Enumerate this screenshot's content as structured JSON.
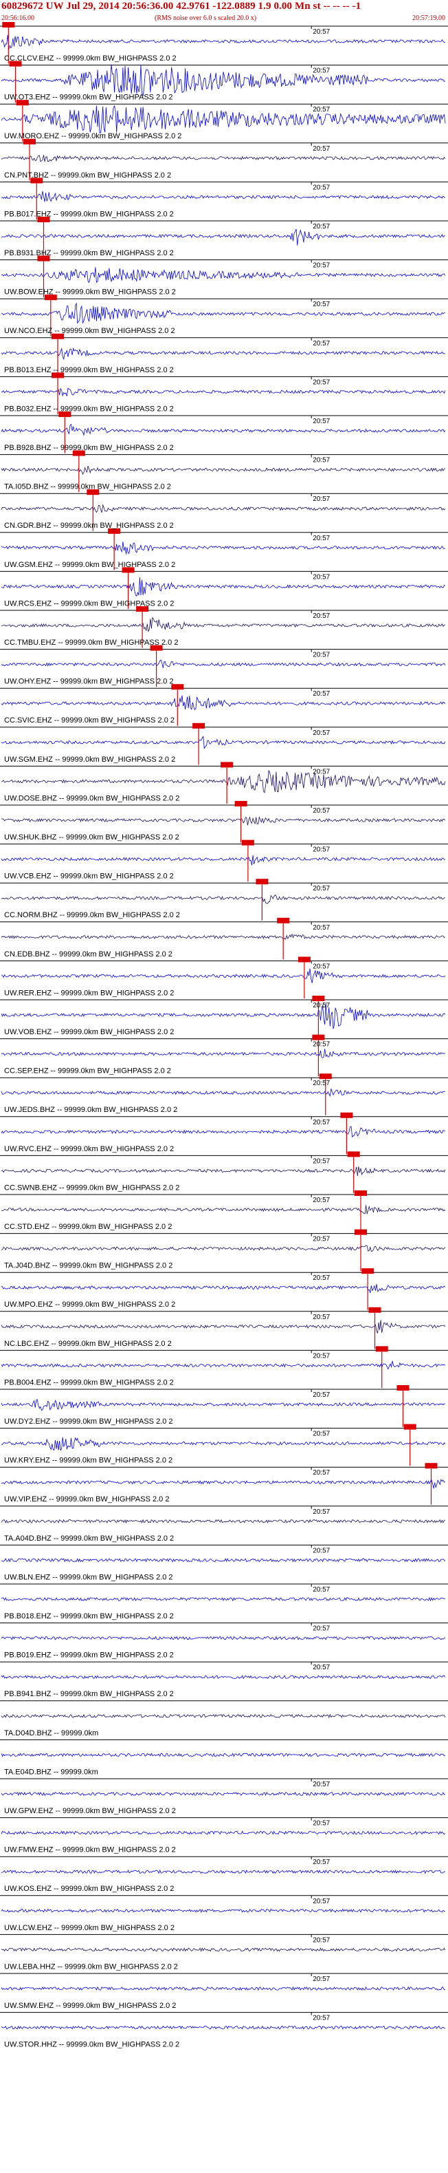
{
  "header": {
    "title": "60829672 UW Jul 29, 2014 20:56:36.00    42.9761 -122.0889  1.9 0.00 Mn st -- -- --  -1",
    "start_time": "20:56:16.00",
    "scale_note": "(RMS noise over 6.0 s scaled 20.0 x)",
    "end_time": "20:57:19.00"
  },
  "colors": {
    "trace_blue": "#0000ee",
    "trace_dark": "#1a0a66",
    "pick_red": "#dd0000",
    "baseline": "#000000",
    "header_red": "#c00000"
  },
  "chart_data": {
    "type": "line",
    "title": "60829672 UW Jul 29, 2014 20:56:36.00    42.9761 -122.0889  1.9 0.00 Mn st -- -- --  -1",
    "time_axis": {
      "start": "20:56:16.00",
      "end": "20:57:19.00"
    },
    "tick_label": "20:57",
    "series": [
      {
        "name": "CC.CLCV.EHZ -- 99999.0km BW_HIGHPASS  2.0  2",
        "color": "#0000ee",
        "pick": "20:56:17",
        "burst_start": "20:56:16",
        "burst_end": "20:56:22",
        "amp": 0.55
      },
      {
        "name": "UW.OT3.EHZ -- 99999.0km BW_HIGHPASS  2.0  2",
        "color": "#0000ee",
        "pick": "20:56:18",
        "burst_start": "20:56:25",
        "burst_end": "20:57:08",
        "amp": 1.0
      },
      {
        "name": "UW.MORO.EHZ -- 99999.0km BW_HIGHPASS  2.0  2",
        "color": "#0000ee",
        "pick": "20:56:19",
        "burst_start": "20:56:19",
        "burst_end": "20:57:19",
        "amp": 0.8
      },
      {
        "name": "CN.PNT.BHZ -- 99999.0km BW_HIGHPASS  2.0  2",
        "color": "#1a0a66",
        "pick": "20:56:20",
        "burst_start": "20:56:20",
        "burst_end": "20:56:28",
        "amp": 0.15
      },
      {
        "name": "PB.B017.EHZ -- 99999.0km BW_HIGHPASS  2.0  2",
        "color": "#0000ee",
        "pick": "20:56:21",
        "burst_start": "20:56:21",
        "burst_end": "20:56:26",
        "amp": 0.3
      },
      {
        "name": "PB.B931.BHZ -- 99999.0km BW_HIGHPASS  2.0  2",
        "color": "#0000ee",
        "pick": "20:56:22",
        "burst_start": "20:56:57",
        "burst_end": "20:57:01",
        "amp": 0.55
      },
      {
        "name": "UW.BOW.EHZ -- 99999.0km BW_HIGHPASS  2.0  2",
        "color": "#0000ee",
        "pick": "20:56:22",
        "burst_start": "20:56:22",
        "burst_end": "20:56:58",
        "amp": 0.4
      },
      {
        "name": "UW.NCO.EHZ -- 99999.0km BW_HIGHPASS  2.0  2",
        "color": "#0000ee",
        "pick": "20:56:23",
        "burst_start": "20:56:23",
        "burst_end": "20:56:40",
        "amp": 0.6
      },
      {
        "name": "PB.B013.EHZ -- 99999.0km BW_HIGHPASS  2.0  2",
        "color": "#0000ee",
        "pick": "20:56:24",
        "burst_start": "20:56:24",
        "burst_end": "20:56:29",
        "amp": 0.3
      },
      {
        "name": "PB.B032.EHZ -- 99999.0km BW_HIGHPASS  2.0  2",
        "color": "#0000ee",
        "pick": "20:56:24",
        "burst_start": "20:56:24",
        "burst_end": "20:56:28",
        "amp": 0.3
      },
      {
        "name": "PB.B928.BHZ -- 99999.0km BW_HIGHPASS  2.0  2",
        "color": "#0000ee",
        "pick": "20:56:25",
        "burst_start": "20:56:25",
        "burst_end": "20:56:31",
        "amp": 0.35
      },
      {
        "name": "TA.I05D.BHZ -- 99999.0km BW_HIGHPASS  2.0  2",
        "color": "#1a0a66",
        "pick": "20:56:27",
        "burst_start": "20:56:27",
        "burst_end": "20:56:30",
        "amp": 0.25
      },
      {
        "name": "CN.GDR.BHZ -- 99999.0km BW_HIGHPASS  2.0  2",
        "color": "#1a0a66",
        "pick": "20:56:29",
        "burst_start": "20:56:29",
        "burst_end": "20:56:32",
        "amp": 0.25
      },
      {
        "name": "UW.GSM.EHZ -- 99999.0km BW_HIGHPASS  2.0  2",
        "color": "#0000ee",
        "pick": "20:56:32",
        "burst_start": "20:56:32",
        "burst_end": "20:56:38",
        "amp": 0.45
      },
      {
        "name": "UW.RCS.EHZ -- 99999.0km BW_HIGHPASS  2.0  2",
        "color": "#0000ee",
        "pick": "20:56:34",
        "burst_start": "20:56:34",
        "burst_end": "20:56:41",
        "amp": 0.55
      },
      {
        "name": "CC.TMBU.EHZ -- 99999.0km BW_HIGHPASS  2.0  2",
        "color": "#1a0a66",
        "pick": "20:56:36",
        "burst_start": "20:56:36",
        "burst_end": "20:56:42",
        "amp": 0.45
      },
      {
        "name": "UW.OHY.EHZ -- 99999.0km BW_HIGHPASS  2.0  2",
        "color": "#0000ee",
        "pick": "20:56:38",
        "burst_start": "20:56:38",
        "burst_end": "20:56:41",
        "amp": 0.3
      },
      {
        "name": "CC.SVIC.EHZ -- 99999.0km BW_HIGHPASS  2.0  2",
        "color": "#0000ee",
        "pick": "20:56:41",
        "burst_start": "20:56:40",
        "burst_end": "20:56:49",
        "amp": 0.55
      },
      {
        "name": "UW.SGM.EHZ -- 99999.0km BW_HIGHPASS  2.0  2",
        "color": "#0000ee",
        "pick": "20:56:44",
        "burst_start": "20:56:44",
        "burst_end": "20:56:48",
        "amp": 0.3
      },
      {
        "name": "UW.DOSE.BHZ -- 99999.0km BW_HIGHPASS  2.0  2",
        "color": "#1a0a66",
        "pick": "20:56:48",
        "burst_start": "20:56:48",
        "burst_end": "20:57:19",
        "amp": 0.6
      },
      {
        "name": "UW.SHUK.BHZ -- 99999.0km BW_HIGHPASS  2.0  2",
        "color": "#1a0a66",
        "pick": "20:56:50",
        "burst_start": "20:56:50",
        "burst_end": "20:56:55",
        "amp": 0.3
      },
      {
        "name": "UW.VCB.EHZ -- 99999.0km BW_HIGHPASS  2.0  2",
        "color": "#0000ee",
        "pick": "20:56:51",
        "burst_start": "20:56:51",
        "burst_end": "20:56:54",
        "amp": 0.3
      },
      {
        "name": "CC.NORM.BHZ -- 99999.0km BW_HIGHPASS  2.0  2",
        "color": "#1a0a66",
        "pick": "20:56:53",
        "burst_start": "20:56:53",
        "burst_end": "20:56:56",
        "amp": 0.3
      },
      {
        "name": "CN.EDB.BHZ -- 99999.0km BW_HIGHPASS  2.0  2",
        "color": "#1a0a66",
        "pick": "20:56:56",
        "burst_start": "20:56:56",
        "burst_end": "20:56:59",
        "amp": 0.25
      },
      {
        "name": "UW.RER.EHZ -- 99999.0km BW_HIGHPASS  2.0  2",
        "color": "#0000ee",
        "pick": "20:56:59",
        "burst_start": "20:56:59",
        "burst_end": "20:57:03",
        "amp": 0.4
      },
      {
        "name": "UW.VOB.EHZ -- 99999.0km BW_HIGHPASS  2.0  2",
        "color": "#0000ee",
        "pick": "20:57:01",
        "burst_start": "20:57:01",
        "burst_end": "20:57:08",
        "amp": 1.0
      },
      {
        "name": "CC.SEP.EHZ -- 99999.0km BW_HIGHPASS  2.0  2",
        "color": "#0000ee",
        "pick": "20:57:01",
        "burst_start": "20:57:01",
        "burst_end": "20:57:04",
        "amp": 0.3
      },
      {
        "name": "UW.JEDS.BHZ -- 99999.0km BW_HIGHPASS  2.0  2",
        "color": "#0000ee",
        "pick": "20:57:02",
        "burst_start": "20:57:02",
        "burst_end": "20:57:05",
        "amp": 0.2
      },
      {
        "name": "UW.RVC.EHZ -- 99999.0km BW_HIGHPASS  2.0  2",
        "color": "#0000ee",
        "pick": "20:57:05",
        "burst_start": "20:57:05",
        "burst_end": "20:57:09",
        "amp": 0.3
      },
      {
        "name": "CC.SWNB.EHZ -- 99999.0km BW_HIGHPASS  2.0  2",
        "color": "#1a0a66",
        "pick": "20:57:06",
        "burst_start": "20:57:06",
        "burst_end": "20:57:09",
        "amp": 0.25
      },
      {
        "name": "CC.STD.EHZ -- 99999.0km BW_HIGHPASS  2.0  2",
        "color": "#1a0a66",
        "pick": "20:57:07",
        "burst_start": "20:57:07",
        "burst_end": "20:57:10",
        "amp": 0.25
      },
      {
        "name": "TA.J04D.BHZ -- 99999.0km BW_HIGHPASS  2.0  2",
        "color": "#1a0a66",
        "pick": "20:57:07",
        "burst_start": "20:57:07",
        "burst_end": "20:57:10",
        "amp": 0.25
      },
      {
        "name": "UW.MPO.EHZ -- 99999.0km BW_HIGHPASS  2.0  2",
        "color": "#0000ee",
        "pick": "20:57:08",
        "burst_start": "20:57:08",
        "burst_end": "20:57:11",
        "amp": 0.45
      },
      {
        "name": "NC.LBC.EHZ -- 99999.0km BW_HIGHPASS  2.0  2",
        "color": "#1a0a66",
        "pick": "20:57:09",
        "burst_start": "20:57:09",
        "burst_end": "20:57:12",
        "amp": 0.4
      },
      {
        "name": "PB.B004.EHZ -- 99999.0km BW_HIGHPASS  2.0  2",
        "color": "#0000ee",
        "pick": "20:57:10",
        "burst_start": "20:57:10",
        "burst_end": "20:57:13",
        "amp": 0.4
      },
      {
        "name": "UW.DY2.EHZ -- 99999.0km BW_HIGHPASS  2.0  2",
        "color": "#0000ee",
        "pick": "20:57:13",
        "burst_start": "20:56:20",
        "burst_end": "20:56:30",
        "amp": 0.35
      },
      {
        "name": "UW.KRY.EHZ -- 99999.0km BW_HIGHPASS  2.0  2",
        "color": "#0000ee",
        "pick": "20:57:14",
        "burst_start": "20:56:22",
        "burst_end": "20:56:30",
        "amp": 0.55
      },
      {
        "name": "UW.VIP.EHZ -- 99999.0km BW_HIGHPASS  2.0  2",
        "color": "#0000ee",
        "pick": "20:57:17",
        "burst_start": "20:57:17",
        "burst_end": "20:57:19",
        "amp": 0.3
      },
      {
        "name": "TA.A04D.BHZ -- 99999.0km BW_HIGHPASS  2.0  2",
        "color": "#1a0a66",
        "pick": "",
        "burst_start": "",
        "burst_end": "",
        "amp": 0.2
      },
      {
        "name": "UW.BLN.EHZ -- 99999.0km BW_HIGHPASS  2.0  2",
        "color": "#0000ee",
        "pick": "",
        "burst_start": "",
        "burst_end": "",
        "amp": 0.2
      },
      {
        "name": "PB.B018.EHZ -- 99999.0km BW_HIGHPASS  2.0  2",
        "color": "#0000ee",
        "pick": "",
        "burst_start": "",
        "burst_end": "",
        "amp": 0.2
      },
      {
        "name": "PB.B019.EHZ -- 99999.0km BW_HIGHPASS  2.0  2",
        "color": "#0000ee",
        "pick": "",
        "burst_start": "",
        "burst_end": "",
        "amp": 0.2
      },
      {
        "name": "PB.B941.BHZ -- 99999.0km BW_HIGHPASS  2.0  2",
        "color": "#0000ee",
        "pick": "",
        "burst_start": "",
        "burst_end": "",
        "amp": 0.2
      },
      {
        "name": "TA.D04D.BHZ -- 99999.0km",
        "color": "#1a0a66",
        "pick": "",
        "burst_start": "",
        "burst_end": "",
        "amp": 0.0
      },
      {
        "name": "TA.E04D.BHZ -- 99999.0km",
        "color": "#0000ee",
        "pick": "",
        "burst_start": "",
        "burst_end": "",
        "amp": 0.2
      },
      {
        "name": "UW.GPW.EHZ -- 99999.0km BW_HIGHPASS  2.0  2",
        "color": "#0000ee",
        "pick": "",
        "burst_start": "",
        "burst_end": "",
        "amp": 0.2
      },
      {
        "name": "UW.FMW.EHZ -- 99999.0km BW_HIGHPASS  2.0  2",
        "color": "#0000ee",
        "pick": "",
        "burst_start": "",
        "burst_end": "",
        "amp": 0.2
      },
      {
        "name": "UW.KOS.EHZ -- 99999.0km BW_HIGHPASS  2.0  2",
        "color": "#0000ee",
        "pick": "",
        "burst_start": "",
        "burst_end": "",
        "amp": 0.2
      },
      {
        "name": "UW.LCW.EHZ -- 99999.0km BW_HIGHPASS  2.0  2",
        "color": "#0000ee",
        "pick": "",
        "burst_start": "",
        "burst_end": "",
        "amp": 0.2
      },
      {
        "name": "UW.LEBA.HHZ -- 99999.0km BW_HIGHPASS  2.0  2",
        "color": "#1a0a66",
        "pick": "",
        "burst_start": "",
        "burst_end": "",
        "amp": 0.2
      },
      {
        "name": "UW.SMW.EHZ -- 99999.0km BW_HIGHPASS  2.0  2",
        "color": "#0000ee",
        "pick": "",
        "burst_start": "",
        "burst_end": "",
        "amp": 0.2
      },
      {
        "name": "UW.STOR.HHZ -- 99999.0km BW_HIGHPASS  2.0  2",
        "color": "#0000ee",
        "pick": "",
        "burst_start": "",
        "burst_end": "",
        "amp": 0.2
      }
    ]
  }
}
